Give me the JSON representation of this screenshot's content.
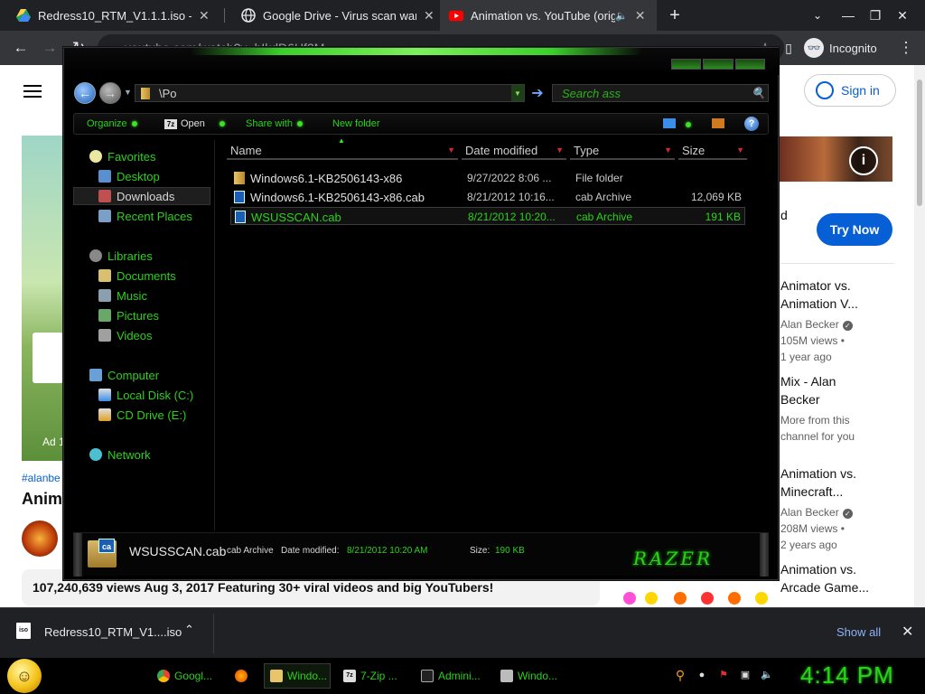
{
  "browser": {
    "tabs": [
      {
        "title": "Redress10_RTM_V1.1.1.iso - Goo"
      },
      {
        "title": "Google Drive - Virus scan warnin"
      },
      {
        "title": "Animation vs. YouTube (origi"
      }
    ],
    "new_tab": "+",
    "url": "youtube.com/watch?v=hIkdD6Hf3M",
    "incognito_label": "Incognito"
  },
  "youtube": {
    "sign_in": "Sign in",
    "ad_d": "d",
    "try_now": "Try Now",
    "ad_label": "Ad 1",
    "hashtag": "#alanbe",
    "video_title": "Anim",
    "description": "107,240,639 views  Aug 3, 2017  Featuring 30+ viral videos and big YouTubers!",
    "recommendations": [
      {
        "title1": "Animator vs.",
        "title2": "Animation V...",
        "channel": "Alan Becker",
        "views": "105M views •",
        "age": "1 year ago"
      },
      {
        "title1": "Mix - Alan",
        "title2": "Becker",
        "channel": "More from this",
        "views": "channel for you",
        "age": ""
      },
      {
        "title1": "Animation vs.",
        "title2": "Minecraft...",
        "channel": "Alan Becker",
        "views": "208M views •",
        "age": "2 years ago"
      },
      {
        "title1": "Animation vs.",
        "title2": "Arcade Game...",
        "channel": "",
        "views": "",
        "age": ""
      }
    ]
  },
  "explorer": {
    "address": "\\Po",
    "search_placeholder": "Search ass",
    "commands": {
      "organize": "Organize",
      "open": "Open",
      "share": "Share with",
      "new_folder": "New folder"
    },
    "nav": {
      "favorites": "Favorites",
      "desktop": "Desktop",
      "downloads": "Downloads",
      "recent": "Recent Places",
      "libraries": "Libraries",
      "documents": "Documents",
      "music": "Music",
      "pictures": "Pictures",
      "videos": "Videos",
      "computer": "Computer",
      "local_disk": "Local Disk (C:)",
      "cd_drive": "CD Drive (E:)",
      "network": "Network"
    },
    "columns": {
      "name": "Name",
      "date": "Date modified",
      "type": "Type",
      "size": "Size"
    },
    "files": [
      {
        "name": "Windows6.1-KB2506143-x86",
        "date": "9/27/2022 8:06 ...",
        "type": "File folder",
        "size": ""
      },
      {
        "name": "Windows6.1-KB2506143-x86.cab",
        "date": "8/21/2012 10:16...",
        "type": "cab Archive",
        "size": "12,069 KB"
      },
      {
        "name": "WSUSSCAN.cab",
        "date": "8/21/2012 10:20...",
        "type": "cab Archive",
        "size": "191 KB"
      }
    ],
    "details": {
      "name": "WSUSSCAN.cab",
      "type": "cab Archive",
      "date_label": "Date modified:",
      "date_value": "8/21/2012 10:20 AM",
      "size_label": "Size:",
      "size_value": "190 KB",
      "icon_text": "ca",
      "brand": "RAZER"
    }
  },
  "downloads": {
    "file_icon_text": "iso",
    "file": "Redress10_RTM_V1....iso",
    "show_all": "Show all"
  },
  "taskbar": {
    "tasks": [
      {
        "label": "Googl..."
      },
      {
        "label": ""
      },
      {
        "label": "Windo..."
      },
      {
        "label": "7-Zip ..."
      },
      {
        "label": "Admini..."
      },
      {
        "label": "Windo..."
      }
    ],
    "clock": "4:14 PM"
  }
}
